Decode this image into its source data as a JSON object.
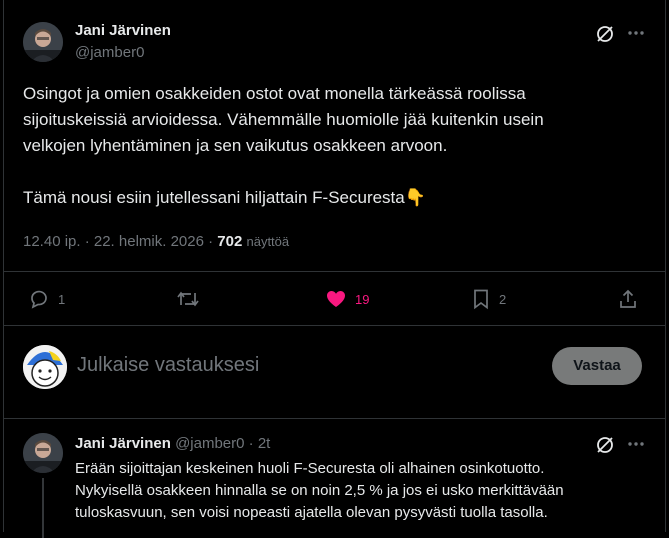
{
  "post": {
    "author_name": "Jani Järvinen",
    "author_handle": "@jamber0",
    "lines": [
      "Osingot ja omien osakkeiden ostot ovat monella tärkeässä roolissa",
      "sijoituskeissiä arvioidessa. Vähemmälle huomiolle jää kuitenkin usein",
      "velkojen lyhentäminen ja sen vaikutus osakkeen arvoon.",
      "Tämä nousi esiin jutellessani hiljattain F-Securesta👇"
    ],
    "timestamp": "12.40 ip. · 22. helmik. 2026 ·",
    "views_count": "702",
    "views_label": "näyttöä",
    "replies": "1",
    "reposts": "",
    "likes": "19",
    "bookmarks": "2"
  },
  "composer": {
    "placeholder": "Julkaise vastauksesi",
    "reply_button": "Vastaa"
  },
  "reply": {
    "author_name": "Jani Järvinen",
    "author_handle": "@jamber0",
    "dot": "·",
    "time": "2t",
    "lines": [
      "Erään sijoittajan keskeinen huoli F-Securesta oli alhainen osinkotuotto.",
      "Nykyisellä osakkeen hinnalla se on noin 2,5 % ja jos ei usko merkittävään",
      "tuloskasvuun, sen voisi nopeasti ajatella olevan pysyvästi tuolla tasolla."
    ]
  },
  "colors": {
    "like_active": "#f91880",
    "muted": "#71767b",
    "border": "#2f3336"
  },
  "icons": [
    "grok-icon",
    "more-icon",
    "reply-icon",
    "repost-icon",
    "like-icon",
    "bookmark-icon",
    "share-icon"
  ]
}
